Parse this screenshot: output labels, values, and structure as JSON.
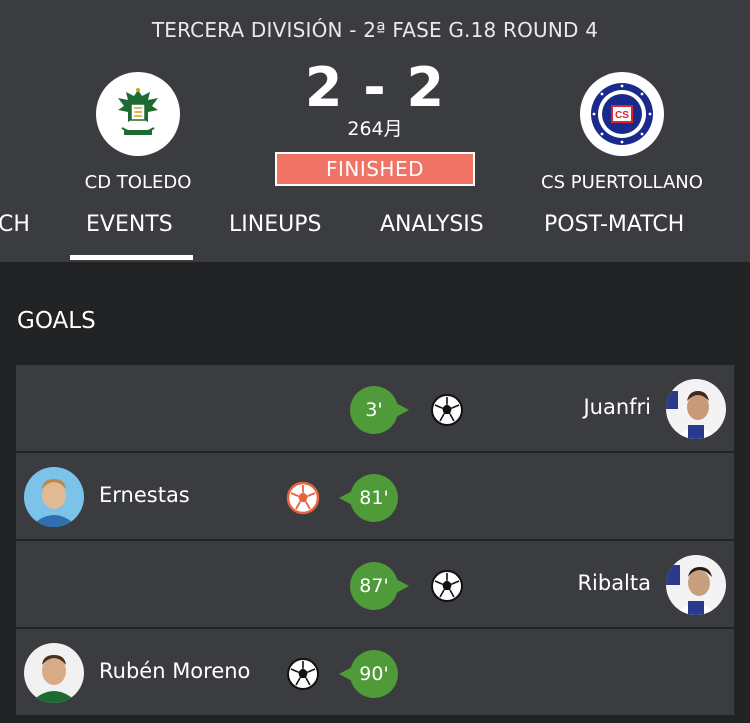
{
  "match": {
    "competition": "TERCERA DIVISIÓN - 2ª FASE G.18 ROUND 4",
    "home_team": "CD TOLEDO",
    "away_team": "CS PUERTOLLANO",
    "score": "2 - 2",
    "date": "264月",
    "status": "FINISHED",
    "status_color": "#ef7466"
  },
  "tabs": [
    {
      "label": "CH"
    },
    {
      "label": "EVENTS",
      "active": true
    },
    {
      "label": "LINEUPS"
    },
    {
      "label": "ANALYSIS"
    },
    {
      "label": "POST-MATCH"
    }
  ],
  "goals": {
    "title": "GOALS",
    "events": [
      {
        "player": "Juanfri",
        "minute": "3'",
        "side": "away",
        "ball_icon": "soccer-ball-icon"
      },
      {
        "player": "Ernestas",
        "minute": "81'",
        "side": "home",
        "ball_icon": "own-goal-ball-icon"
      },
      {
        "player": "Ribalta",
        "minute": "87'",
        "side": "away",
        "ball_icon": "soccer-ball-icon"
      },
      {
        "player": "Rubén Moreno",
        "minute": "90'",
        "side": "home",
        "ball_icon": "soccer-ball-icon"
      }
    ]
  },
  "colors": {
    "header_bg": "#3a3c3f",
    "page_bg": "#222325",
    "minute_badge": "#4f9a39",
    "own_goal": "#e8643c"
  }
}
